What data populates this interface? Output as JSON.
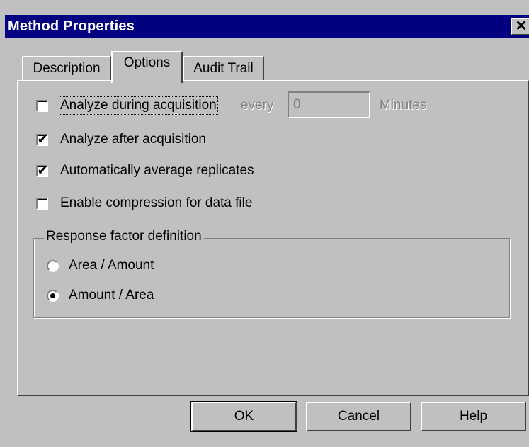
{
  "window": {
    "title": "Method Properties",
    "close_glyph": "✕"
  },
  "tabs": [
    {
      "label": "Description",
      "active": false
    },
    {
      "label": "Options",
      "active": true
    },
    {
      "label": "Audit Trail",
      "active": false
    }
  ],
  "options": {
    "analyze_during": {
      "label": "Analyze during acquisition",
      "checked": false
    },
    "every_label": "every",
    "minutes_value": "0",
    "minutes_label": "Minutes",
    "analyze_after": {
      "label": "Analyze after acquisition",
      "checked": true
    },
    "average_replicates": {
      "label": "Automatically average replicates",
      "checked": true
    },
    "enable_compression": {
      "label": "Enable compression for data file",
      "checked": false
    }
  },
  "response_factor": {
    "title": "Response factor definition",
    "options": [
      {
        "label": "Area / Amount",
        "selected": false
      },
      {
        "label": "Amount / Area",
        "selected": true
      }
    ]
  },
  "buttons": {
    "ok": "OK",
    "cancel": "Cancel",
    "help": "Help"
  },
  "check_mark": "✔"
}
